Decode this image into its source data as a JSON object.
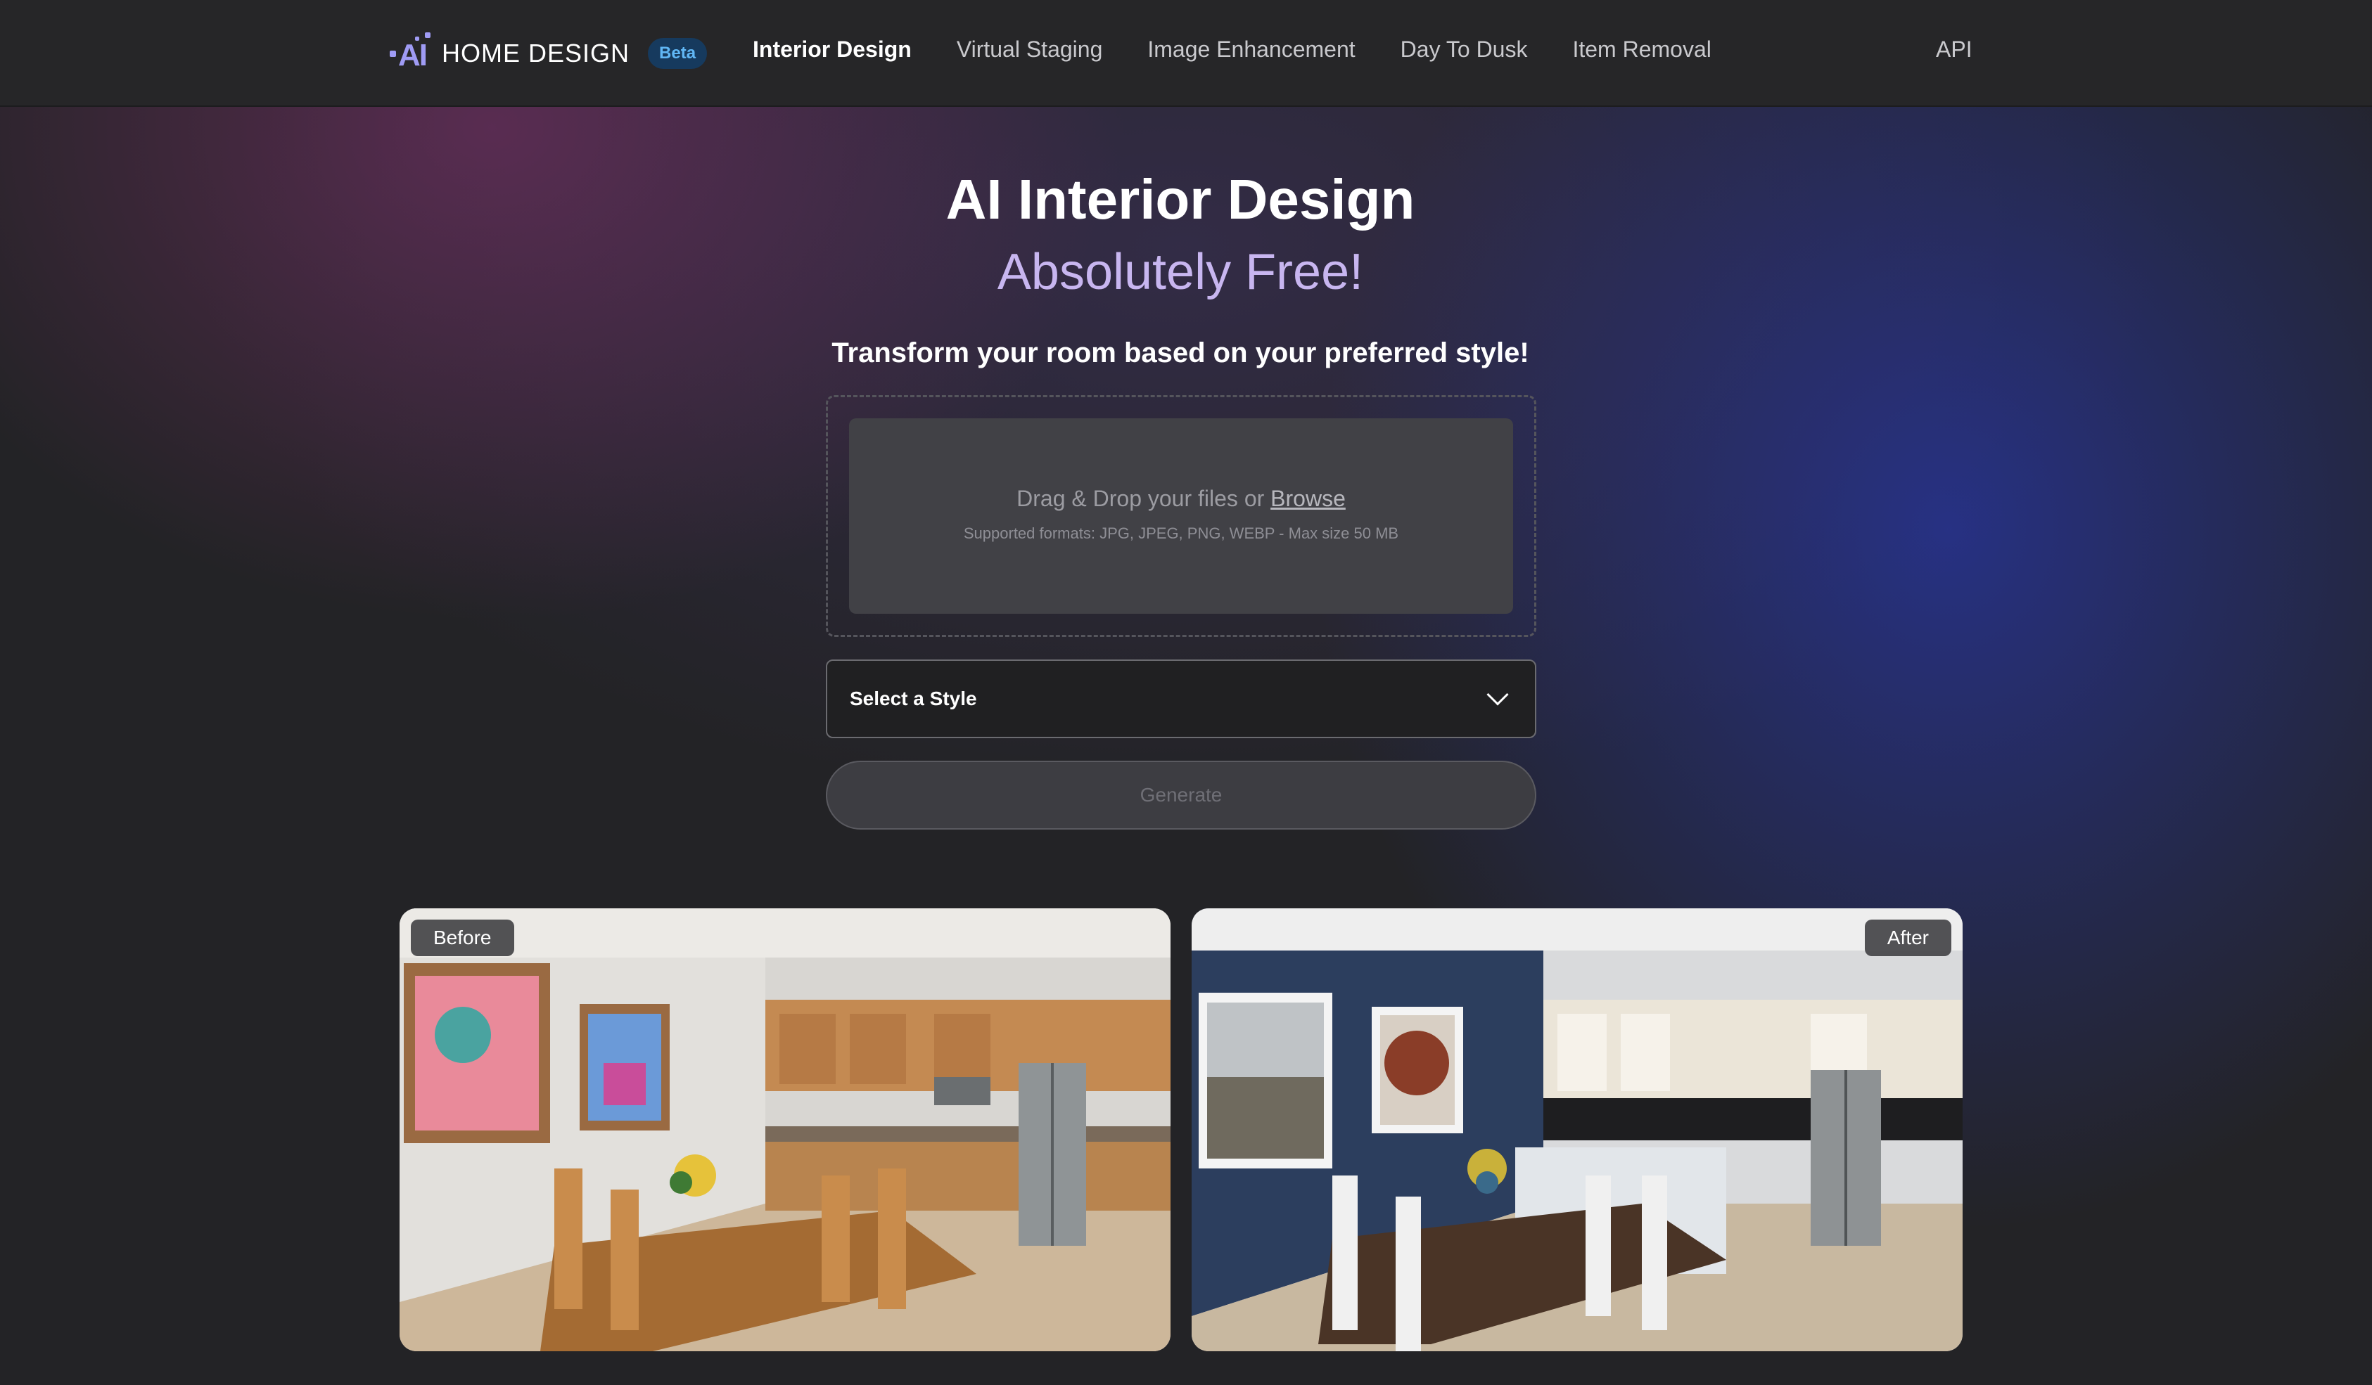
{
  "header": {
    "logo_text": "HOME DESIGN",
    "beta_badge": "Beta",
    "nav": [
      {
        "label": "Interior Design",
        "active": true
      },
      {
        "label": "Virtual Staging",
        "active": false
      },
      {
        "label": "Image Enhancement",
        "active": false
      },
      {
        "label": "Day To Dusk",
        "active": false
      },
      {
        "label": "Item Removal",
        "active": false
      }
    ],
    "api_label": "API"
  },
  "hero": {
    "title": "AI Interior Design",
    "subtitle": "Absolutely Free!",
    "tagline": "Transform your room based on your preferred style!"
  },
  "upload": {
    "drop_text": "Drag & Drop your files or",
    "browse_label": "Browse",
    "hint": "Supported formats: JPG, JPEG, PNG, WEBP - Max size 50 MB"
  },
  "style_select": {
    "placeholder": "Select a Style"
  },
  "generate_label": "Generate",
  "comparison": {
    "before_label": "Before",
    "after_label": "After"
  },
  "colors": {
    "accent": "#9f9bf4",
    "subtitle": "#c8b6f0",
    "beta_bg": "#163a5e",
    "beta_text": "#61b7f5"
  }
}
